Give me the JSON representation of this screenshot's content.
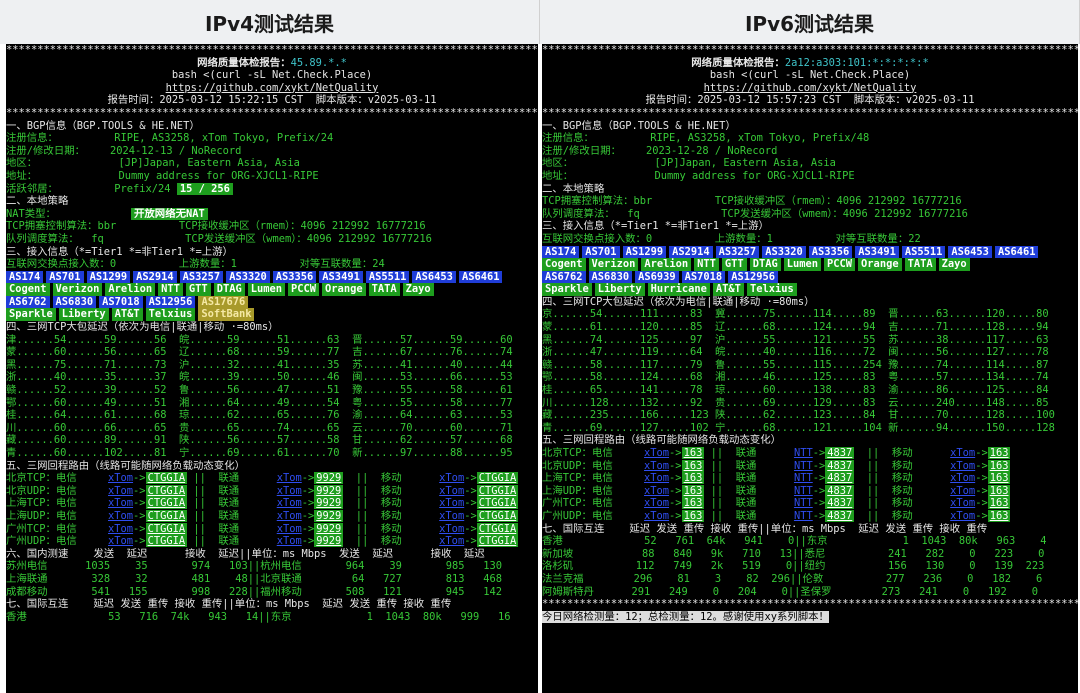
{
  "headers": {
    "left": "IPv4测试结果",
    "right": "IPv6测试结果"
  },
  "left": {
    "stars": "**************************************************************************************************************",
    "title_label": "网络质量体检报告：",
    "title_ip": "45.89.*.*",
    "cmd": "bash <(curl -sL Net.Check.Place)",
    "url": "https://github.com/xykt/NetQuality",
    "report_time": "报告时间：2025-03-12 15:22:15 CST  脚本版本：v2025-03-11",
    "bgp_head": "一、BGP信息（BGP.TOOLS & HE.NET）",
    "reg_label": "注册信息：",
    "reg_value": "RIPE, AS3258, xTom Tokyo, Prefix/24",
    "date_label": "注册/修改日期：",
    "date_value": "2024-12-13 / NoRecord",
    "area_label": "地区：",
    "area_value": "[JP]Japan, Eastern Asia, Asia",
    "addr_label": "地址：",
    "addr_value": "Dummy address for ORG-XJCL1-RIPE",
    "neighbor_label": "活跃邻居：",
    "neighbor_value": "Prefix/24",
    "neighbor_badge": "15 / 256",
    "policy_head": "二、本地策略",
    "nat_label": "NAT类型：",
    "nat_badge": "开放网络无NAT",
    "tcp_cc": "TCP拥塞控制算法：bbr          TCP接收缓冲区（rmem）：4096 212992 16777216",
    "qdisc": "队列调度算法：  fq             TCP发送缓冲区（wmem）：4096 212992 16777216",
    "access_head": "三、接入信息（*=Tier1 *=非Tier1 *=上游）",
    "ix_line": "互联网交换点接入数：0          上游数量：1          对等互联数量：24",
    "as_row1": [
      "AS174",
      "AS701",
      "AS1299",
      "AS2914",
      "AS3257",
      "AS3320",
      "AS3356",
      "AS3491",
      "AS5511",
      "AS6453",
      "AS6461"
    ],
    "name_row1": [
      "Cogent",
      "Verizon",
      "Arelion",
      "NTT",
      "GTT",
      "DTAG",
      "Lumen",
      "PCCW",
      "Orange",
      "TATA",
      "Zayo"
    ],
    "as_row2": [
      "AS6762",
      "AS6830",
      "AS7018",
      "AS12956",
      "AS17676"
    ],
    "name_row2": [
      "Sparkle",
      "Liberty",
      "AT&T",
      "Telxius",
      "SoftBank"
    ],
    "tcp_head": "四、三网TCP大包延迟（依次为电信|联通|移动 ·=80ms）",
    "tcp_rows": [
      "津......54......59......56  皖......59......51......63  晋......57......59......60",
      "蒙......60......56......65  辽......68......59......77  吉......67......76......74",
      "黑......75......71......73  沪......32......41......35  苏......41......40......44",
      "浙......40......35......37  皖......39......50......46  闽......53......66......53",
      "赣......52......39......52  鲁......56......47......51  豫......55......58......61",
      "鄂......60......49......51  湘......64......49......54  粤......55......58......77",
      "桂......64......61......68  琼......62......65......76  渝......64......63......53",
      "川......60......66......65  贵......65......74......65  云......70......60......71",
      "藏......60......89......91  陕......56......57......58  甘......62......57......68",
      "青......60......102.....81  宁......69......61......70  新......97......88......95"
    ],
    "route_head": "五、三网回程路由（线路可能随网络负载动态变化）",
    "route_rows": [
      {
        "label": "北京TCP：电信",
        "a": "xTom",
        "b": "CTGGIA",
        "c": "联通",
        "d": "xTom",
        "e": "9929",
        "f": "移动",
        "g": "xTom",
        "h": "CTGGIA"
      },
      {
        "label": "北京UDP：电信",
        "a": "xTom",
        "b": "CTGGIA",
        "c": "联通",
        "d": "xTom",
        "e": "9929",
        "f": "移动",
        "g": "xTom",
        "h": "CTGGIA"
      },
      {
        "label": "上海TCP：电信",
        "a": "xTom",
        "b": "CTGGIA",
        "c": "联通",
        "d": "xTom",
        "e": "9929",
        "f": "移动",
        "g": "xTom",
        "h": "CTGGIA"
      },
      {
        "label": "上海UDP：电信",
        "a": "xTom",
        "b": "CTGGIA",
        "c": "联通",
        "d": "xTom",
        "e": "9929",
        "f": "移动",
        "g": "xTom",
        "h": "CTGGIA"
      },
      {
        "label": "广州TCP：电信",
        "a": "xTom",
        "b": "CTGGIA",
        "c": "联通",
        "d": "xTom",
        "e": "9929",
        "f": "移动",
        "g": "xTom",
        "h": "CTGGIA"
      },
      {
        "label": "广州UDP：电信",
        "a": "xTom",
        "b": "CTGGIA",
        "c": "联通",
        "d": "xTom",
        "e": "9929",
        "f": "移动",
        "g": "xTom",
        "h": "CTGGIA"
      }
    ],
    "speed_head": "六、国内测速    发送  延迟      接收  延迟||单位：ms Mbps  发送  延迟      接收  延迟",
    "speed_rows": [
      "苏州电信      1035    35       974   103||杭州电信       964    39       985   130",
      "上海联通       328    32       481    48||北京联通        64   727       813   468",
      "成都移动       541   155       998   228||福州移动       508   121       945   142"
    ],
    "intl_head": "七、国际互连    延迟 发送 重传 接收 重传||单位：ms Mbps  延迟 发送 重传 接收 重传",
    "intl_row": "香港             53   716  74k   943   14||东京            1  1043  80k   999   16"
  },
  "right": {
    "stars": "**************************************************************************************************************",
    "title_label": "网络质量体检报告：",
    "title_ip": "2a12:a303:101:*:*:*:*:*",
    "cmd": "bash <(curl -sL Net.Check.Place)",
    "url": "https://github.com/xykt/NetQuality",
    "report_time": "报告时间：2025-03-12 15:57:23 CST  脚本版本：v2025-03-11",
    "bgp_head": "一、BGP信息（BGP.TOOLS & HE.NET）",
    "reg_label": "注册信息：",
    "reg_value": "RIPE, AS3258, xTom Tokyo, Prefix/48",
    "date_label": "注册/修改日期：",
    "date_value": "2023-12-28 / NoRecord",
    "area_label": "地区：",
    "area_value": "[JP]Japan, Eastern Asia, Asia",
    "addr_label": "地址：",
    "addr_value": "Dummy address for ORG-XJCL1-RIPE",
    "policy_head": "二、本地策略",
    "tcp_cc": "TCP拥塞控制算法：bbr          TCP接收缓冲区（rmem）：4096 212992 16777216",
    "qdisc": "队列调度算法：  fq             TCP发送缓冲区（wmem）：4096 212992 16777216",
    "access_head": "三、接入信息（*=Tier1 *=非Tier1 *=上游）",
    "ix_line": "互联网交换点接入数：0          上游数量：1          对等互联数量：22",
    "as_row1": [
      "AS174",
      "AS701",
      "AS1299",
      "AS2914",
      "AS3257",
      "AS3320",
      "AS3356",
      "AS3491",
      "AS5511",
      "AS6453",
      "AS6461"
    ],
    "name_row1": [
      "Cogent",
      "Verizon",
      "Arelion",
      "NTT",
      "GTT",
      "DTAG",
      "Lumen",
      "PCCW",
      "Orange",
      "TATA",
      "Zayo"
    ],
    "as_row2": [
      "AS6762",
      "AS6830",
      "AS6939",
      "AS7018",
      "AS12956"
    ],
    "name_row2": [
      "Sparkle",
      "Liberty",
      "Hurricane",
      "AT&T",
      "Telxius"
    ],
    "tcp_head": "四、三网TCP大包延迟（依次为电信|联通|移动 ·=80ms）",
    "tcp_rows": [
      "京......54......111.....83  冀......75......114.....89  晋......63......120.....80",
      "蒙......61......120.....85  辽......68......124.....94  吉......71......128.....94",
      "黑......74......125.....97  沪......55......121.....55  苏......38......117.....63",
      "浙......47......119.....64  皖......40......116.....72  闽......56......127.....78",
      "赣......58......117.....79  鲁......55......115.....254 豫......74......114.....87",
      "鄂......58......124.....68  湘......46......125.....83  粤......57......134.....74",
      "桂......65......141.....78  琼......60......138.....83  渝......86......125.....84",
      "川......128.....132.....92  贵......69......129.....83  云......240.....148.....85",
      "藏......235.....166.....123 陕......62......123.....84  甘......70......128.....100",
      "青......69......127.....102 宁......68......121.....104 新......94......150.....128"
    ],
    "route_head": "五、三网回程路由（线路可能随网络负载动态变化）",
    "route_rows": [
      {
        "label": "北京TCP：电信",
        "a": "xTom",
        "b": "163",
        "c": "联通",
        "d": "NTT",
        "e": "4837",
        "f": "移动",
        "g": "xTom",
        "h": "163"
      },
      {
        "label": "北京UDP：电信",
        "a": "xTom",
        "b": "163",
        "c": "联通",
        "d": "NTT",
        "e": "4837",
        "f": "移动",
        "g": "xTom",
        "h": "163"
      },
      {
        "label": "上海TCP：电信",
        "a": "xTom",
        "b": "163",
        "c": "联通",
        "d": "NTT",
        "e": "4837",
        "f": "移动",
        "g": "xTom",
        "h": "163"
      },
      {
        "label": "上海UDP：电信",
        "a": "xTom",
        "b": "163",
        "c": "联通",
        "d": "NTT",
        "e": "4837",
        "f": "移动",
        "g": "xTom",
        "h": "163"
      },
      {
        "label": "广州TCP：电信",
        "a": "xTom",
        "b": "163",
        "c": "联通",
        "d": "NTT",
        "e": "4837",
        "f": "移动",
        "g": "xTom",
        "h": "163"
      },
      {
        "label": "广州UDP：电信",
        "a": "xTom",
        "b": "163",
        "c": "联通",
        "d": "NTT",
        "e": "4837",
        "f": "移动",
        "g": "xTom",
        "h": "163"
      }
    ],
    "intl_head": "七、国际互连    延迟 发送 重传 接收 重传||单位：ms Mbps  延迟 发送 重传 接收 重传",
    "intl_rows": [
      "香港             52   761  64k   941    0||东京            1  1043  80k   963    4",
      "新加坡           88   840   9k   710   13||悉尼          241   282    0   223    0",
      "洛杉矶          112   749   2k   519    0||纽约          156   130    0   139  223",
      "法兰克福        296    81    3    82  296||伦敦          277   236    0   182    6",
      "阿姆斯特丹      291   249    0   204    0||圣保罗        273   241    0   192    0"
    ],
    "footer": "今日网络检测量：12；总检测量：12。感谢使用xy系列脚本！"
  }
}
